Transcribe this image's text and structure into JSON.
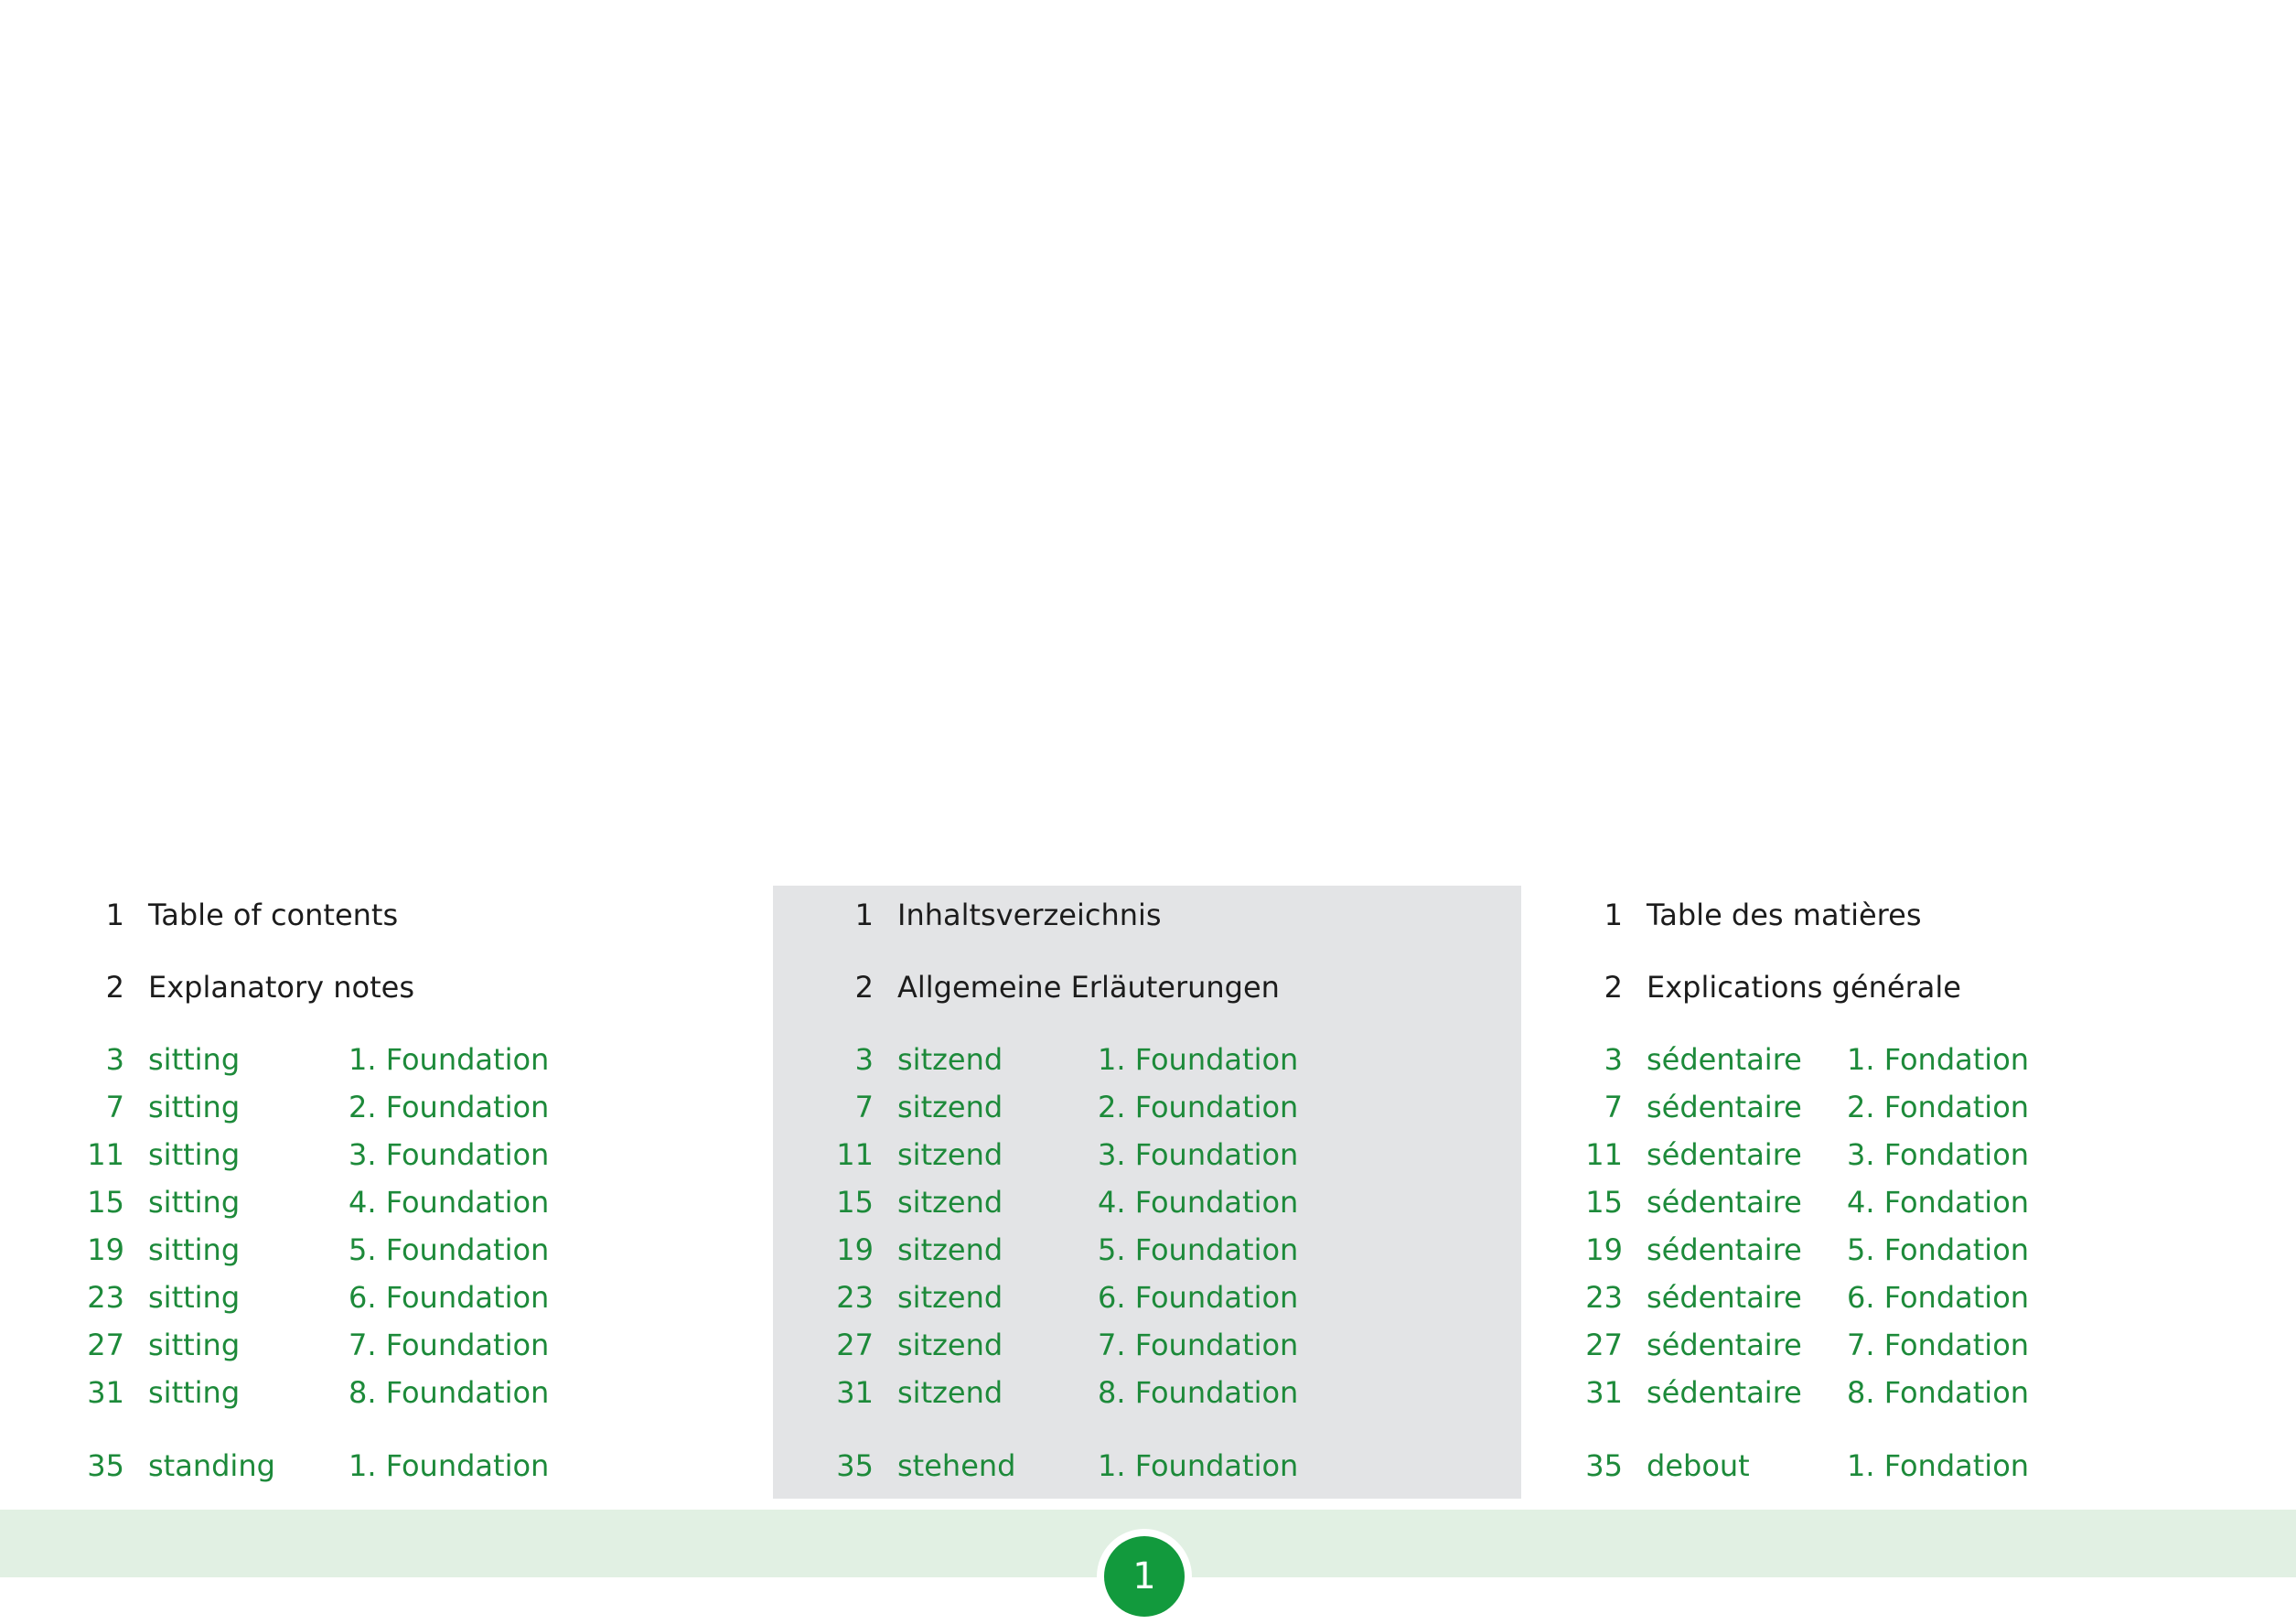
{
  "columns": [
    {
      "toc": [
        {
          "page": "1",
          "title": "Table of contents"
        },
        {
          "page": "2",
          "title": "Explanatory notes"
        }
      ],
      "entries": [
        {
          "page": "3",
          "title": "sitting",
          "foundation": "1. Foundation"
        },
        {
          "page": "7",
          "title": "sitting",
          "foundation": "2. Foundation"
        },
        {
          "page": "11",
          "title": "sitting",
          "foundation": "3. Foundation"
        },
        {
          "page": "15",
          "title": "sitting",
          "foundation": "4. Foundation"
        },
        {
          "page": "19",
          "title": "sitting",
          "foundation": "5. Foundation"
        },
        {
          "page": "23",
          "title": "sitting",
          "foundation": "6. Foundation"
        },
        {
          "page": "27",
          "title": "sitting",
          "foundation": "7. Foundation"
        },
        {
          "page": "31",
          "title": "sitting",
          "foundation": "8. Foundation"
        },
        {
          "page": "35",
          "title": "standing",
          "foundation": "1. Foundation"
        }
      ]
    },
    {
      "toc": [
        {
          "page": "1",
          "title": "Inhaltsverzeichnis"
        },
        {
          "page": "2",
          "title": "Allgemeine Erläuterungen"
        }
      ],
      "entries": [
        {
          "page": "3",
          "title": "sitzend",
          "foundation": "1. Foundation"
        },
        {
          "page": "7",
          "title": "sitzend",
          "foundation": "2. Foundation"
        },
        {
          "page": "11",
          "title": "sitzend",
          "foundation": "3. Foundation"
        },
        {
          "page": "15",
          "title": "sitzend",
          "foundation": "4. Foundation"
        },
        {
          "page": "19",
          "title": "sitzend",
          "foundation": "5. Foundation"
        },
        {
          "page": "23",
          "title": "sitzend",
          "foundation": "6. Foundation"
        },
        {
          "page": "27",
          "title": "sitzend",
          "foundation": "7. Foundation"
        },
        {
          "page": "31",
          "title": "sitzend",
          "foundation": "8. Foundation"
        },
        {
          "page": "35",
          "title": "stehend",
          "foundation": "1. Foundation"
        }
      ]
    },
    {
      "toc": [
        {
          "page": "1",
          "title": "Table des matières"
        },
        {
          "page": "2",
          "title": "Explications générale"
        }
      ],
      "entries": [
        {
          "page": "3",
          "title": "sédentaire",
          "foundation": "1. Fondation"
        },
        {
          "page": "7",
          "title": "sédentaire",
          "foundation": "2. Fondation"
        },
        {
          "page": "11",
          "title": "sédentaire",
          "foundation": "3. Fondation"
        },
        {
          "page": "15",
          "title": "sédentaire",
          "foundation": "4. Fondation"
        },
        {
          "page": "19",
          "title": "sédentaire",
          "foundation": "5. Fondation"
        },
        {
          "page": "23",
          "title": "sédentaire",
          "foundation": "6. Fondation"
        },
        {
          "page": "27",
          "title": "sédentaire",
          "foundation": "7. Fondation"
        },
        {
          "page": "31",
          "title": "sédentaire",
          "foundation": "8. Fondation"
        },
        {
          "page": "35",
          "title": "debout",
          "foundation": "1. Fondation"
        }
      ]
    }
  ],
  "footer": {
    "page_number": "1"
  },
  "colors": {
    "text": "#1c1c1c",
    "green_text": "#1d8a3a",
    "middle_column_bg": "#e3e4e6",
    "footer_band": "#e1f0e3",
    "badge": "#129a3d"
  }
}
